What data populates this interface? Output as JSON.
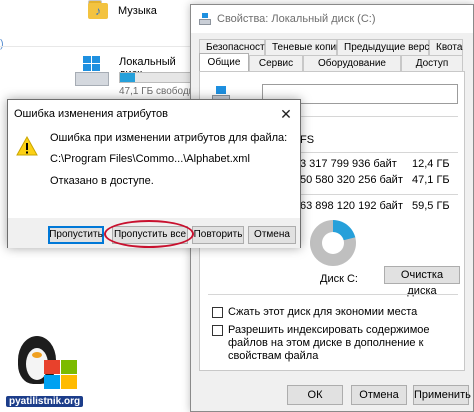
{
  "explorer": {
    "folder_label": "Музыка",
    "left_arrow": ")",
    "drive_label": "Локальный диск",
    "drive_free": "47,1 ГБ свободно",
    "drive_used_fraction": 0.2
  },
  "properties": {
    "title": "Свойства: Локальный диск (C:)",
    "tabs_row1": [
      "Безопасность",
      "Теневые копии",
      "Предыдущие версии",
      "Квота"
    ],
    "tabs_row2": [
      "Общие",
      "Сервис",
      "Оборудование",
      "Доступ"
    ],
    "active_tab": "Общие",
    "name_value": "",
    "fs_fragment": "FS",
    "stats": [
      {
        "bytes": "3 317 799 936 байт",
        "gb": "12,4 ГБ",
        "color": "#26a0da"
      },
      {
        "bytes": "50 580 320 256 байт",
        "gb": "47,1 ГБ",
        "color": "#bfbfbf"
      },
      {
        "bytes": "63 898 120 192 байт",
        "gb": "59,5 ГБ",
        "color": ""
      }
    ],
    "used_fraction": 0.21,
    "disk_label": "Диск C:",
    "cleanup_button": "Очистка диска",
    "compress_label": "Сжать этот диск для экономии места",
    "index_label": "Разрешить индексировать содержимое файлов на этом диске в дополнение к свойствам файла",
    "ok": "ОК",
    "cancel": "Отмена",
    "apply": "Применить"
  },
  "error_dialog": {
    "title": "Ошибка изменения атрибутов",
    "line1": "Ошибка при изменении атрибутов для файла:",
    "line2": "C:\\Program Files\\Commo...\\Alphabet.xml",
    "line3": "Отказано в доступе.",
    "close_glyph": "✕",
    "buttons": {
      "skip": "Пропустить",
      "skip_all": "Пропустить все",
      "retry": "Повторить",
      "cancel": "Отмена"
    }
  },
  "watermark": {
    "text": "pyatilistnik.org"
  }
}
